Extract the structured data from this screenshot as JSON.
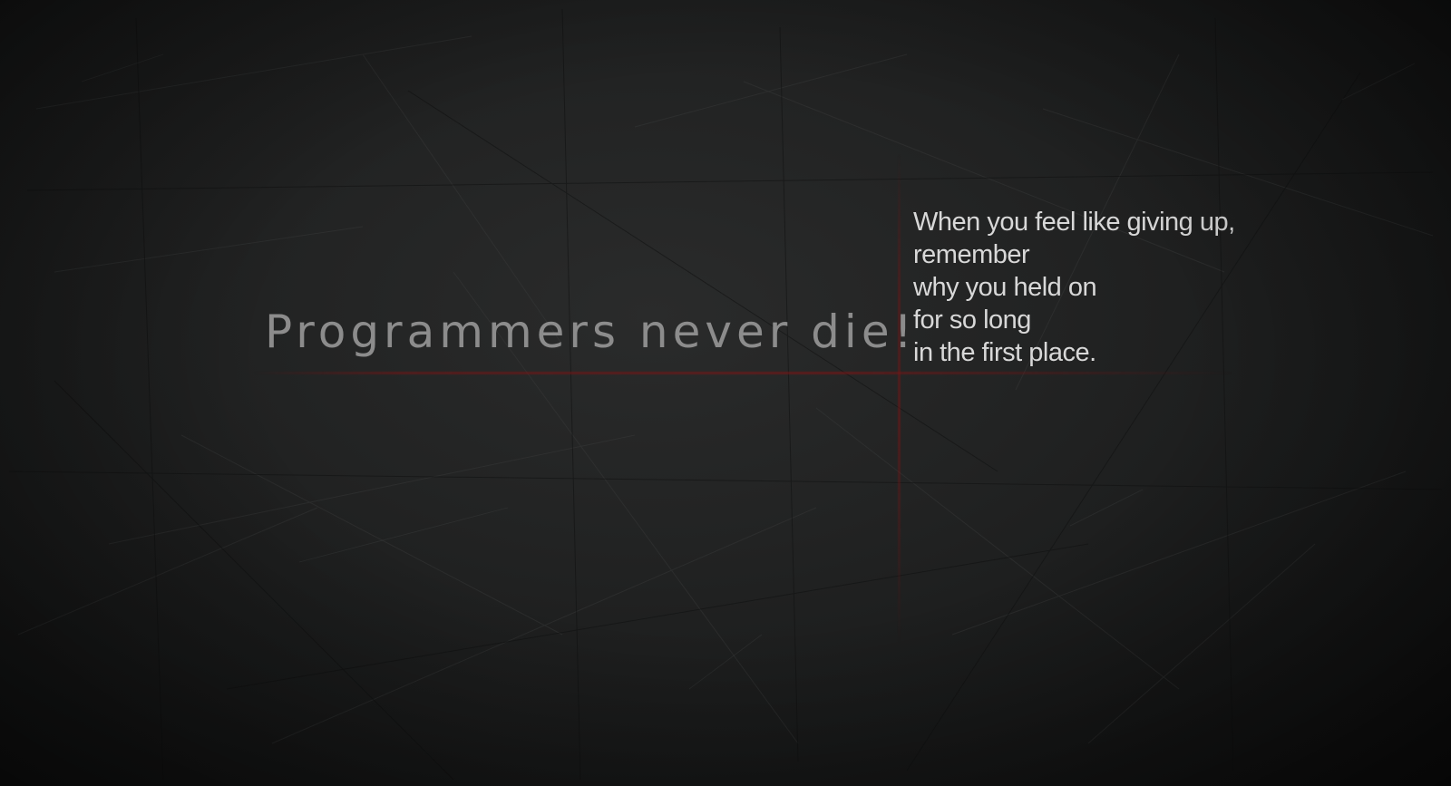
{
  "headline": "Programmers never die!",
  "quote_lines": [
    "When you feel like giving up,",
    "remember",
    "why you held on",
    "for so long",
    "in the first place."
  ],
  "colors": {
    "background": "#1c1d1d",
    "headline": "#8c8c8c",
    "quote": "#d8d8d8",
    "accent_line": "#7d1616"
  }
}
